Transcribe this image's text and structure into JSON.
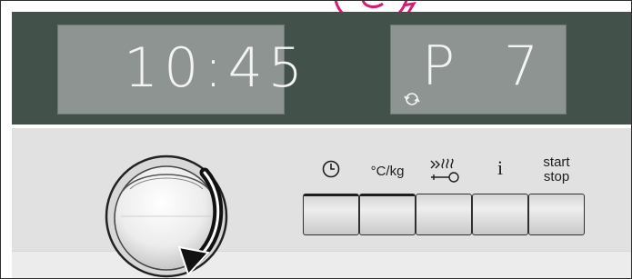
{
  "display": {
    "time": "10:45",
    "program_letter": "P",
    "program_number": "7"
  },
  "buttons": [
    {
      "icon": "clock-icon",
      "label": ""
    },
    {
      "icon": "",
      "label": "°C/kg"
    },
    {
      "icon": "rapid-heat-key-icon",
      "label": ""
    },
    {
      "icon": "",
      "label": "i"
    },
    {
      "icon": "",
      "label": "start",
      "label2": "stop"
    }
  ],
  "colors": {
    "display_panel": "#425149",
    "lcd_background": "#8d9491",
    "lcd_text": "#f4f4f4",
    "control_panel": "#e1e1e1",
    "accent_magenta": "#d81b72"
  }
}
